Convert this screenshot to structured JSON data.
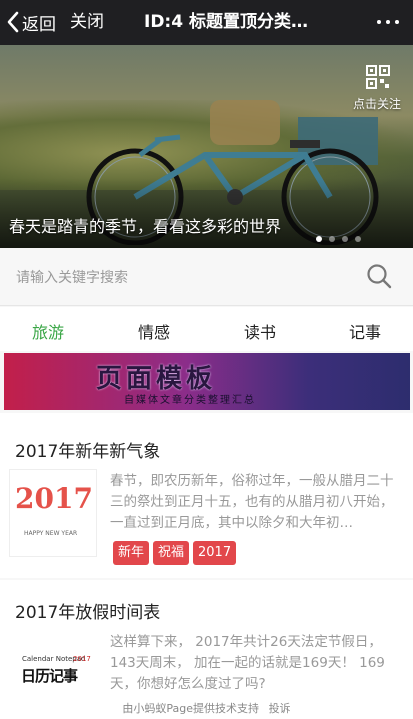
{
  "topbar": {
    "back_label": "返回",
    "close_label": "关闭",
    "title": "ID:4 标题置顶分类…"
  },
  "banner": {
    "follow_label": "点击关注",
    "caption": "春天是踏青的季节，看看这多彩的世界",
    "slide_count": 4,
    "active_slide": 1
  },
  "search": {
    "placeholder": "请输入关键字搜索"
  },
  "tabs": [
    {
      "label": "旅游",
      "active": true
    },
    {
      "label": "情感",
      "active": false
    },
    {
      "label": "读书",
      "active": false
    },
    {
      "label": "记事",
      "active": false
    }
  ],
  "ad_banner": {
    "title": "页面模板",
    "subtitle": "自媒体文章分类整理汇总"
  },
  "articles": [
    {
      "title": "2017年新年新气象",
      "thumb_text": "2017",
      "thumb_sub": "HAPPY NEW YEAR",
      "desc": "春节，即农历新年，俗称过年，一般从腊月二十三的祭灶到正月十五，也有的从腊月初八开始，一直过到正月底，其中以除夕和大年初…",
      "tags": [
        "新年",
        "祝福",
        "2017"
      ]
    },
    {
      "title": "2017年放假时间表",
      "thumb_small": "Calendar Notepad",
      "thumb_year": "2017",
      "thumb_text": "日历记事",
      "desc": "这样算下来， 2017年共计26天法定节假日，143天周末， 加在一起的话就是169天！ 169天，你想好怎么度过了吗?"
    }
  ],
  "footer": {
    "powered": "由小蚂蚁Page提供技术支持",
    "report": "投诉"
  },
  "colors": {
    "accent_green": "#3aa646",
    "tag_red": "#e2474b",
    "topbar_bg": "#1f1f22"
  }
}
